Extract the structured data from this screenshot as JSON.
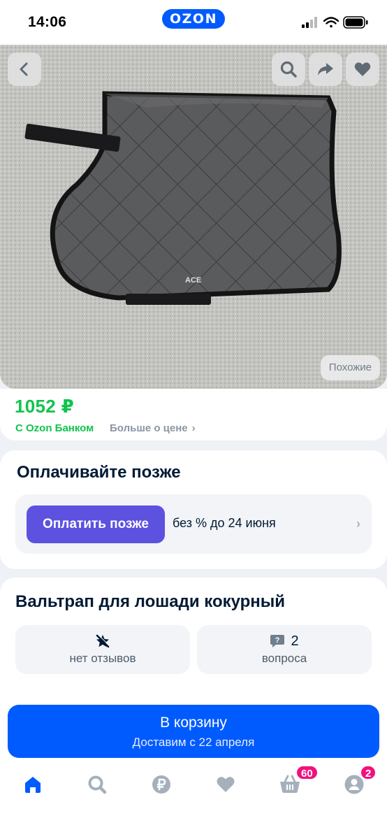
{
  "status_bar": {
    "time": "14:06",
    "logo": "OZON"
  },
  "hero": {
    "icons": [
      "back-icon",
      "search-icon",
      "share-icon",
      "heart-icon"
    ],
    "similar_label": "Похожие",
    "product_mark": "ACE"
  },
  "price": {
    "value": "1052 ₽",
    "bank_label": "С Ozon Банком",
    "more_label": "Больше о цене",
    "more_chevron": "›",
    "accent_color": "#10c44c"
  },
  "pay_later": {
    "title": "Оплачивайте позже",
    "button_label": "Оплатить позже",
    "terms": "без % до 24 июня",
    "chevron": "›",
    "button_color": "#5d51e0"
  },
  "product": {
    "title": "Вальтрап для лошади кокурный",
    "reviews": {
      "icon": "no-star-icon",
      "label": "нет отзывов"
    },
    "questions": {
      "icon": "question-icon",
      "count": "2",
      "label": "вопроса"
    }
  },
  "cart": {
    "button_label": "В корзину",
    "delivery": "Доставим с 22 апреля",
    "button_color": "#005bff"
  },
  "tabbar": {
    "tabs": [
      {
        "name": "home",
        "icon": "home-icon",
        "active": true
      },
      {
        "name": "catalog",
        "icon": "search-icon",
        "active": false
      },
      {
        "name": "payments",
        "icon": "ruble-icon",
        "active": false
      },
      {
        "name": "favorites",
        "icon": "heart-icon",
        "active": false
      },
      {
        "name": "cart",
        "icon": "basket-icon",
        "active": false,
        "badge": "60"
      },
      {
        "name": "profile",
        "icon": "profile-icon",
        "active": false,
        "badge": "2"
      }
    ],
    "active_color": "#005bff",
    "inactive_color": "#a5b0bc"
  }
}
